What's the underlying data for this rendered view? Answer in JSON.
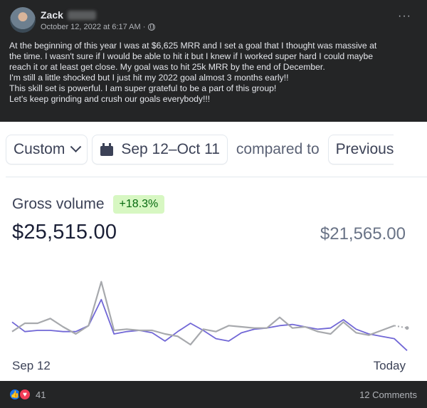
{
  "post": {
    "author": "Zack",
    "timestamp": "October 12, 2022 at 6:17 AM · ",
    "audience_icon": "globe-icon",
    "more_icon": "more-options-icon",
    "more_label": "···",
    "text_lines": [
      "At the beginning of this year I was at $6,625 MRR and I set a goal that I thought was massive at",
      "the time. I wasn't sure if I would be able to hit it but I knew if I worked super hard I could maybe",
      "reach it or at least get close. My goal was to hit 25k MRR by the end of December.",
      "I'm still a little shocked but I just hit my 2022 goal almost 3 months early!!",
      "This skill set is powerful. I am super grateful to be a part of this group!",
      "Let's keep grinding and crush our goals everybody!!!"
    ]
  },
  "dashboard": {
    "range_select": "Custom",
    "date_range": "Sep 12–Oct 11",
    "compared_to": "compared to",
    "compare_select": "Previous",
    "metric_label": "Gross volume",
    "change_badge": "+18.3%",
    "current_value": "$25,515.00",
    "previous_value": "$21,565.00",
    "colors": {
      "current": "#7167d6",
      "previous": "#a7a9ad",
      "badge_bg": "#d7f7c2",
      "badge_text": "#05690d"
    }
  },
  "chart_data": {
    "type": "line",
    "x_start_label": "Sep 12",
    "x_end_label": "Today",
    "series": [
      {
        "values": [
          17,
          24,
          24,
          28,
          21,
          15,
          22,
          59,
          18,
          19,
          18,
          18,
          15,
          13,
          6,
          19,
          17,
          22,
          21,
          20,
          20,
          29,
          20,
          21,
          17,
          15,
          25,
          16,
          14,
          18,
          22,
          20
        ]
      },
      {
        "values": [
          25,
          17,
          18,
          18,
          17,
          17,
          22,
          44,
          15,
          17,
          18,
          16,
          9,
          17,
          24,
          18,
          11,
          9,
          16,
          19,
          20,
          22,
          23,
          21,
          19,
          20,
          27,
          19,
          15,
          13,
          11,
          1
        ]
      }
    ]
  },
  "footer": {
    "like_icon": "like-icon",
    "love_icon": "love-icon",
    "reaction_count": "41",
    "comments": "12 Comments"
  }
}
